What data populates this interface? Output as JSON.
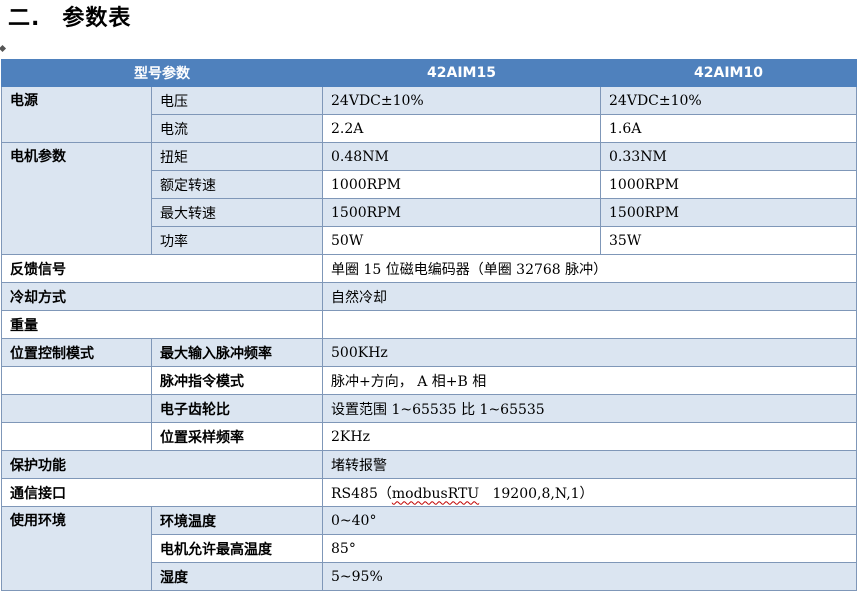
{
  "heading": {
    "number": "二.",
    "title": "参数表"
  },
  "header": {
    "param": "型号参数",
    "model1": "42AIM15",
    "model2": "42AIM10"
  },
  "power": {
    "label": "电源",
    "voltage": {
      "label": "电压",
      "v1": "24VDC±10%",
      "v2": "24VDC±10%"
    },
    "current": {
      "label": "电流",
      "v1": "2.2A",
      "v2": "1.6A"
    }
  },
  "motor": {
    "label": "电机参数",
    "torque": {
      "label": "扭矩",
      "v1": "0.48NM",
      "v2": "0.33NM"
    },
    "rated": {
      "label": "额定转速",
      "v1": "1000RPM",
      "v2": "1000RPM"
    },
    "max": {
      "label": "最大转速",
      "v1": "1500RPM",
      "v2": "1500RPM"
    },
    "power": {
      "label": "功率",
      "v1": "50W",
      "v2": "35W"
    }
  },
  "feedback": {
    "label": "反馈信号",
    "value": "单圈 15 位磁电编码器（单圈 32768 脉冲）"
  },
  "cooling": {
    "label": "冷却方式",
    "value": "自然冷却"
  },
  "weight": {
    "label": "重量",
    "value": ""
  },
  "position": {
    "label": "位置控制模式",
    "max_freq": {
      "label": "最大输入脉冲频率",
      "value": "500KHz"
    },
    "pulse_mode": {
      "label": "脉冲指令模式",
      "value": "脉冲+方向，  A 相+B 相"
    },
    "gear": {
      "label": "电子齿轮比",
      "value": "设置范围 1~65535 比 1~65535"
    },
    "sampling": {
      "label": "位置采样频率",
      "value": "2KHz"
    }
  },
  "protection": {
    "label": "保护功能",
    "value": "堵转报警"
  },
  "comm": {
    "label": "通信接口",
    "prefix": "RS485（",
    "protocol": "modbusRTU",
    "suffix": "   19200,8,N,1）"
  },
  "env": {
    "label": "使用环境",
    "temp": {
      "label": "环境温度",
      "value": "0~40°"
    },
    "motor_temp": {
      "label": "电机允许最高温度",
      "value": "85°"
    },
    "humidity": {
      "label": "湿度",
      "value": "5~95%"
    }
  }
}
